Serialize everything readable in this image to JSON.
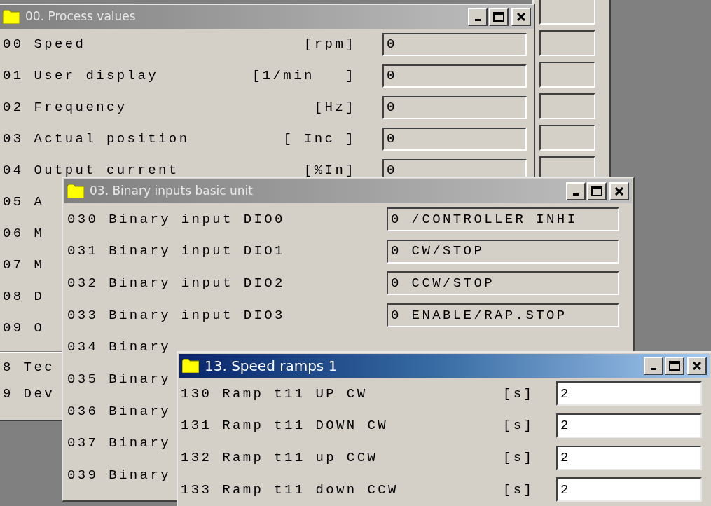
{
  "process_values_window": {
    "title": "00. Process values",
    "active": false,
    "rows": [
      {
        "text": "00 Speed",
        "unit": "[rpm]",
        "value": "0"
      },
      {
        "text": "01 User display",
        "unit": "[1/min   ]",
        "value": "0"
      },
      {
        "text": "02 Frequency",
        "unit": "[Hz]",
        "value": "0"
      },
      {
        "text": "03 Actual position",
        "unit": "[ Inc ]",
        "value": "0"
      },
      {
        "text": "04 Output current",
        "unit": "[%In]",
        "value": "0"
      },
      {
        "text": "05 A"
      },
      {
        "text": "06 M"
      },
      {
        "text": "07 M"
      },
      {
        "text": "08 D"
      },
      {
        "text": "09 O"
      }
    ],
    "lower_rows": [
      {
        "text": "8 Tec"
      },
      {
        "text": "9 Dev"
      }
    ]
  },
  "binary_inputs_window": {
    "title": "03. Binary inputs basic unit",
    "active": false,
    "rows": [
      {
        "text": "030 Binary input DIO0",
        "value": "0 /CONTROLLER INHI"
      },
      {
        "text": "031 Binary input DIO1",
        "value": "0 CW/STOP"
      },
      {
        "text": "032 Binary input DIO2",
        "value": "0 CCW/STOP"
      },
      {
        "text": "033 Binary input DIO3",
        "value": "0 ENABLE/RAP.STOP"
      },
      {
        "text": "034 Binary"
      },
      {
        "text": "035 Binary"
      },
      {
        "text": "036 Binary"
      },
      {
        "text": "037 Binary"
      },
      {
        "text": "039 Binary"
      }
    ]
  },
  "speed_ramps_window": {
    "title": "13. Speed ramps 1",
    "active": true,
    "rows": [
      {
        "text": "130 Ramp t11 UP CW",
        "unit": "[s]",
        "value": "2"
      },
      {
        "text": "131 Ramp t11 DOWN CW",
        "unit": "[s]",
        "value": "2"
      },
      {
        "text": "132 Ramp t11 up CCW",
        "unit": "[s]",
        "value": "2"
      },
      {
        "text": "133 Ramp t11 down CCW",
        "unit": "[s]",
        "value": "2"
      }
    ]
  }
}
